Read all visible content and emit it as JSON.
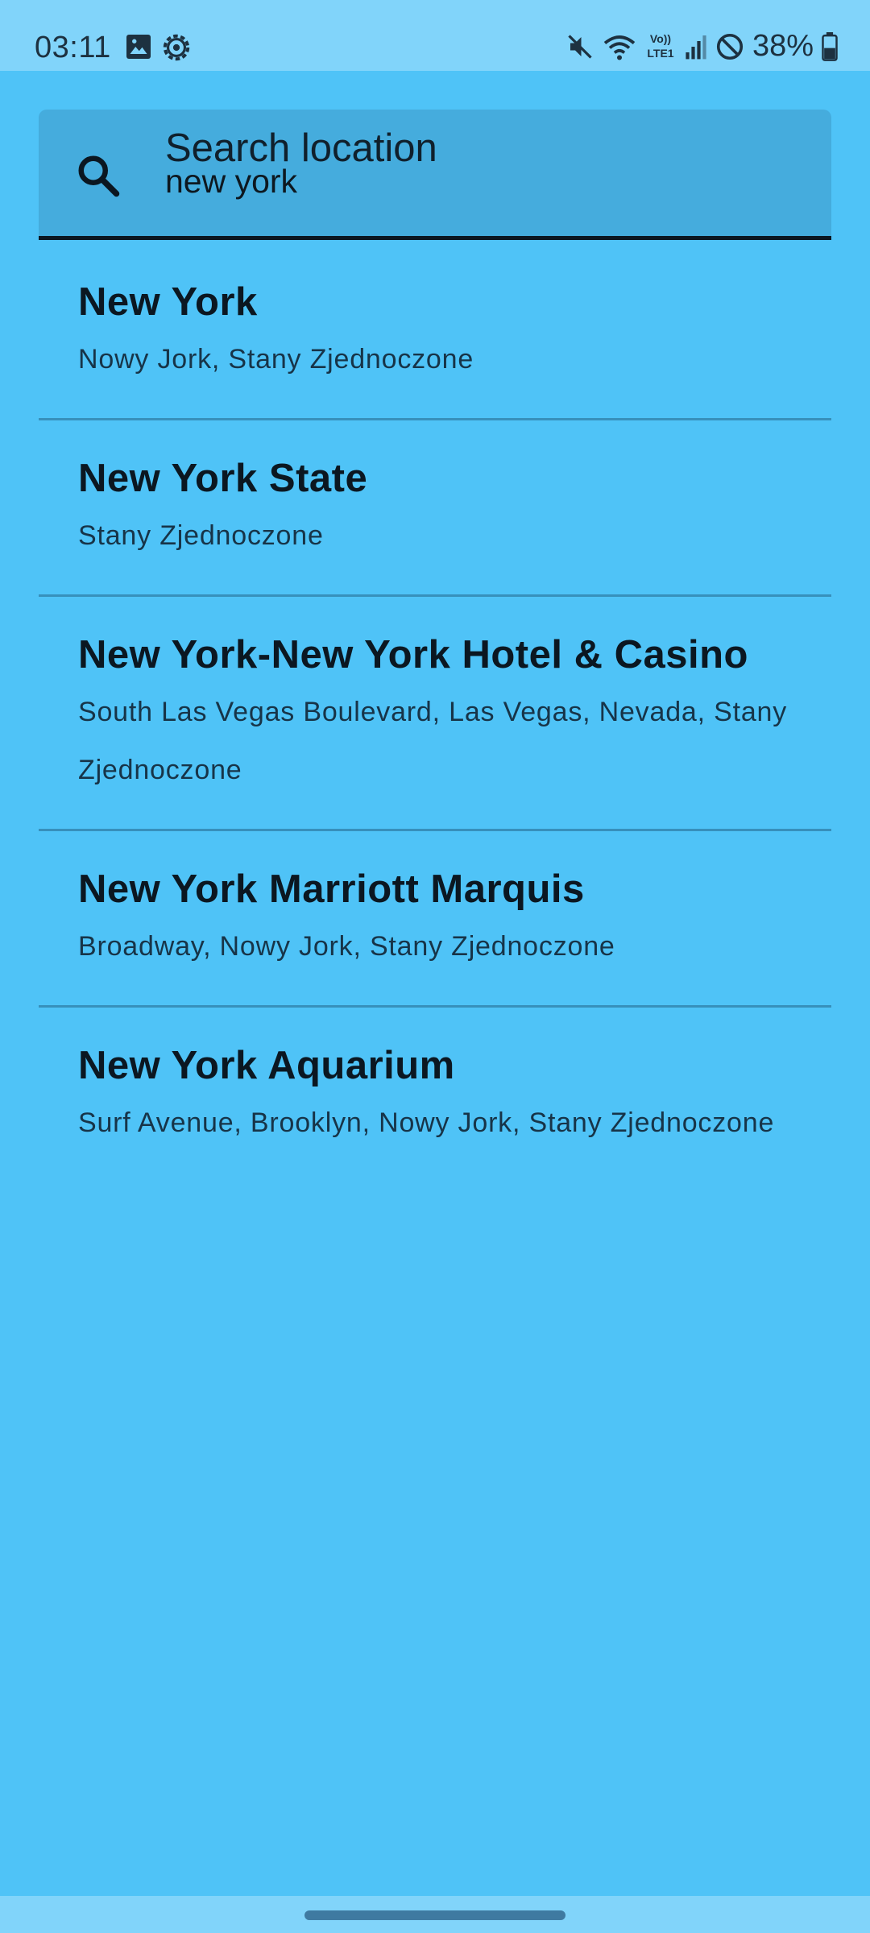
{
  "status_bar": {
    "time": "03:11",
    "battery": "38%",
    "icons": [
      "image-icon",
      "gear-icon",
      "mute-icon",
      "wifi-icon",
      "volte-icon",
      "signal-icon",
      "do-not-disturb-icon",
      "battery-icon"
    ],
    "volte_line1": "Vo))",
    "volte_line2": "LTE1"
  },
  "search": {
    "label": "Search location",
    "value": "new york"
  },
  "results": [
    {
      "title": "New York",
      "subtitle": "Nowy Jork, Stany Zjednoczone"
    },
    {
      "title": "New York State",
      "subtitle": "Stany Zjednoczone"
    },
    {
      "title": "New York-New York Hotel & Casino",
      "subtitle": "South Las Vegas Boulevard, Las Vegas, Nevada, Stany Zjednoczone"
    },
    {
      "title": "New York Marriott Marquis",
      "subtitle": "Broadway, Nowy Jork, Stany Zjednoczone"
    },
    {
      "title": "New York Aquarium",
      "subtitle": "Surf Avenue, Brooklyn, Nowy Jork, Stany Zjednoczone"
    }
  ],
  "colors": {
    "background": "#4fc3f7",
    "status_bar": "#81d4fa",
    "search_field": "#45acdd",
    "text": "#0b1721"
  }
}
